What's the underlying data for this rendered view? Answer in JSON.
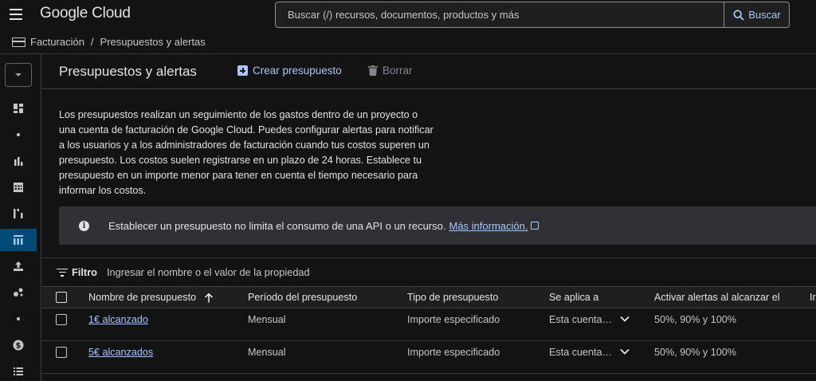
{
  "header": {
    "logo": "Google Cloud",
    "search_placeholder": "Buscar (/) recursos, documentos, productos y más",
    "search_button": "Buscar"
  },
  "breadcrumb": {
    "items": [
      "Facturación",
      "Presupuestos y alertas"
    ]
  },
  "rail": {
    "items": [
      "dashboard-icon",
      "dot",
      "bar-chart-icon",
      "table-icon",
      "cost-breakdown-icon",
      "budgets-icon",
      "upload-icon",
      "pricing-icon",
      "dot",
      "dollar-icon",
      "list-icon"
    ],
    "active": "budgets-icon"
  },
  "page": {
    "title": "Presupuestos y alertas",
    "create_label": "Crear presupuesto",
    "delete_label": "Borrar",
    "description": "Los presupuestos realizan un seguimiento de los gastos dentro de un proyecto o una cuenta de facturación de Google Cloud. Puedes configurar alertas para notificar a los usuarios y a los administradores de facturación cuando tus costos superen un presupuesto. Los costos suelen registrarse en un plazo de 24 horas. Establece tu presupuesto en un importe menor para tener en cuenta el tiempo necesario para informar los costos.",
    "info_text": "Establecer un presupuesto no limita el consumo de una API o un recurso.",
    "info_link": "Más información."
  },
  "filter": {
    "label": "Filtro",
    "placeholder": "Ingresar el nombre o el valor de la propiedad"
  },
  "table": {
    "columns": [
      "Nombre de presupuesto",
      "Período del presupuesto",
      "Tipo de presupuesto",
      "Se aplica a",
      "Activar alertas al alcanzar el",
      "Ir"
    ],
    "rows": [
      {
        "name": "1€ alcanzado",
        "period": "Mensual",
        "type": "Importe especificado",
        "applies": "Esta cuenta…",
        "alerts": "50%, 90% y 100%"
      },
      {
        "name": "5€ alcanzados",
        "period": "Mensual",
        "type": "Importe especificado",
        "applies": "Esta cuenta…",
        "alerts": "50%, 90% y 100%"
      }
    ]
  },
  "colors": {
    "background": "#131314",
    "link": "#a8c7fa",
    "active_rail": "#004a77",
    "info_box": "#303134"
  }
}
